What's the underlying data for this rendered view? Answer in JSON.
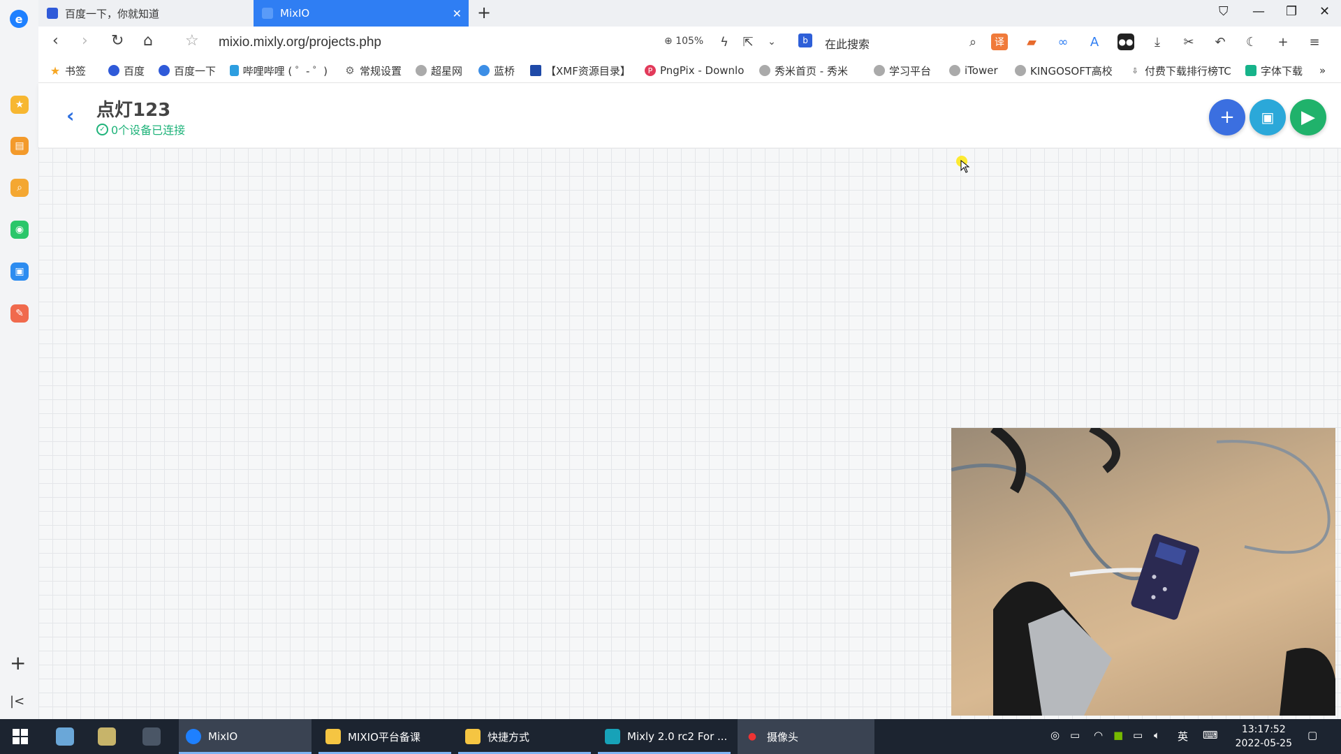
{
  "browser": {
    "tabs": [
      {
        "label": "百度一下，你就知道"
      },
      {
        "label": "MixIO"
      }
    ],
    "url": "mixio.mixly.org/projects.php",
    "zoom": "105%",
    "search_placeholder": "在此搜索",
    "bookmarks": [
      {
        "label": "书签"
      },
      {
        "label": "百度"
      },
      {
        "label": "百度一下"
      },
      {
        "label": "哔哩哔哩 ( ゜- ゜)"
      },
      {
        "label": "常规设置"
      },
      {
        "label": "超星网"
      },
      {
        "label": "蓝桥"
      },
      {
        "label": "【XMF资源目录】"
      },
      {
        "label": "PngPix - Downlo"
      },
      {
        "label": "秀米首页 - 秀米"
      },
      {
        "label": "学习平台"
      },
      {
        "label": "iTower"
      },
      {
        "label": "KINGOSOFT高校"
      },
      {
        "label": "付费下载排行榜TC"
      },
      {
        "label": "字体下载"
      }
    ]
  },
  "app": {
    "project_title": "点灯123",
    "status": "0个设备已连接",
    "colors": {
      "add_button": "#3b6fe0",
      "save_button": "#2ba8d9",
      "run_button": "#20b26b"
    }
  },
  "taskbar": {
    "items": [
      {
        "label": "MixIO"
      },
      {
        "label": "MIXIO平台备课"
      },
      {
        "label": "快捷方式"
      },
      {
        "label": "Mixly 2.0 rc2 For ..."
      },
      {
        "label": "摄像头"
      }
    ],
    "ime": "英",
    "time": "13:17:52",
    "date": "2022-05-25"
  }
}
